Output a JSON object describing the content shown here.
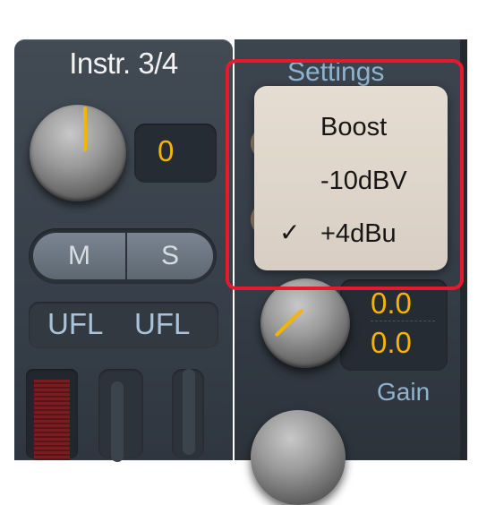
{
  "channel": {
    "title": "Instr. 3/4",
    "gain_value": "0",
    "mute_label": "M",
    "solo_label": "S",
    "ufl_left": "UFL",
    "ufl_right": "UFL"
  },
  "right_strip": {
    "settings_label": "Settings",
    "pan_value_1": "0.0",
    "pan_value_2": "0.0",
    "gain_label": "Gain"
  },
  "dropdown": {
    "items": [
      {
        "label": "Boost",
        "checked": false
      },
      {
        "label": "-10dBV",
        "checked": false
      },
      {
        "label": "+4dBu",
        "checked": true
      }
    ],
    "checkmark": "✓"
  },
  "colors": {
    "accent": "#f4b400",
    "label_blue": "#8fb3cf",
    "highlight": "#e6192d",
    "menu_bg": "#e0d7cc"
  }
}
